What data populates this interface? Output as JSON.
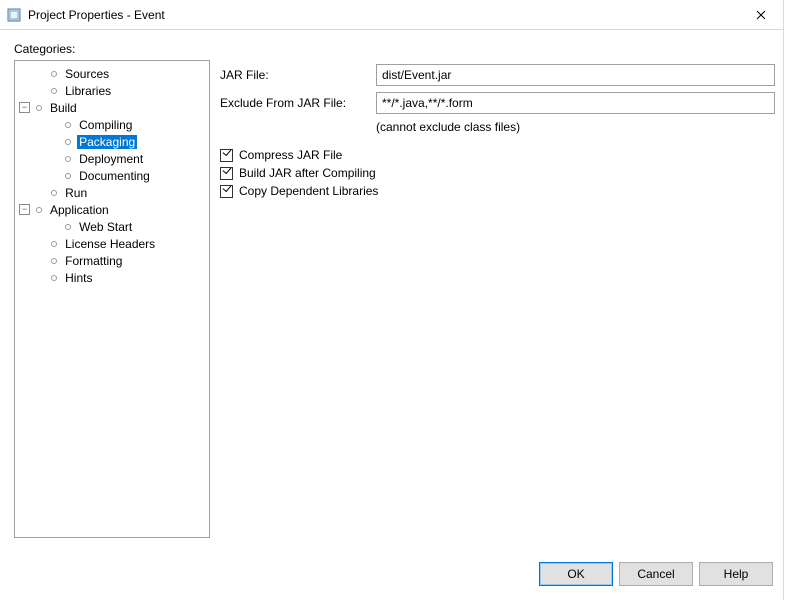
{
  "window": {
    "title": "Project Properties - Event"
  },
  "categories_label": "Categories:",
  "tree": {
    "sources": "Sources",
    "libraries": "Libraries",
    "build": "Build",
    "compiling": "Compiling",
    "packaging": "Packaging",
    "deployment": "Deployment",
    "documenting": "Documenting",
    "run": "Run",
    "application": "Application",
    "webstart": "Web Start",
    "license_headers": "License Headers",
    "formatting": "Formatting",
    "hints": "Hints"
  },
  "form": {
    "jar_file_label": "JAR File:",
    "jar_file_value": "dist/Event.jar",
    "exclude_label": "Exclude From JAR File:",
    "exclude_value": "**/*.java,**/*.form",
    "exclude_hint": "(cannot exclude class files)",
    "compress_label": "Compress JAR File",
    "build_after_label": "Build JAR after Compiling",
    "copy_libs_label": "Copy Dependent Libraries"
  },
  "buttons": {
    "ok": "OK",
    "cancel": "Cancel",
    "help": "Help"
  }
}
